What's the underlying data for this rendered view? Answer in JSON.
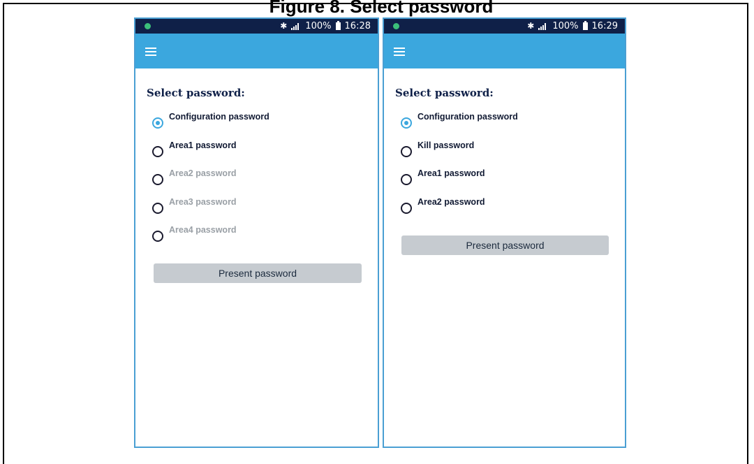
{
  "figure": {
    "cropped_title": "Figure 8. Select password"
  },
  "phones": [
    {
      "status": {
        "bluetooth": "✱",
        "battery": "100%",
        "time": "16:28"
      },
      "heading": "Select password:",
      "options": [
        {
          "label": "Configuration password",
          "selected": true,
          "enabled": true
        },
        {
          "label": "Area1 password",
          "selected": false,
          "enabled": true
        },
        {
          "label": "Area2 password",
          "selected": false,
          "enabled": false
        },
        {
          "label": "Area3 password",
          "selected": false,
          "enabled": false
        },
        {
          "label": "Area4 password",
          "selected": false,
          "enabled": false
        }
      ],
      "button": "Present password"
    },
    {
      "status": {
        "bluetooth": "✱",
        "battery": "100%",
        "time": "16:29"
      },
      "heading": "Select password:",
      "options": [
        {
          "label": "Configuration password",
          "selected": true,
          "enabled": true
        },
        {
          "label": "Kill password",
          "selected": false,
          "enabled": true
        },
        {
          "label": "Area1 password",
          "selected": false,
          "enabled": true
        },
        {
          "label": "Area2 password",
          "selected": false,
          "enabled": true
        }
      ],
      "button": "Present password"
    }
  ],
  "colors": {
    "status_bar": "#0f2048",
    "app_bar": "#3ba7de",
    "radio_selected": "#3ba7de",
    "button_bg": "#c6cbd0",
    "disabled_text": "#9aa0a6"
  },
  "icons": [
    "menu-icon",
    "bluetooth-icon",
    "signal-icon",
    "battery-icon",
    "notification-dot-icon"
  ]
}
